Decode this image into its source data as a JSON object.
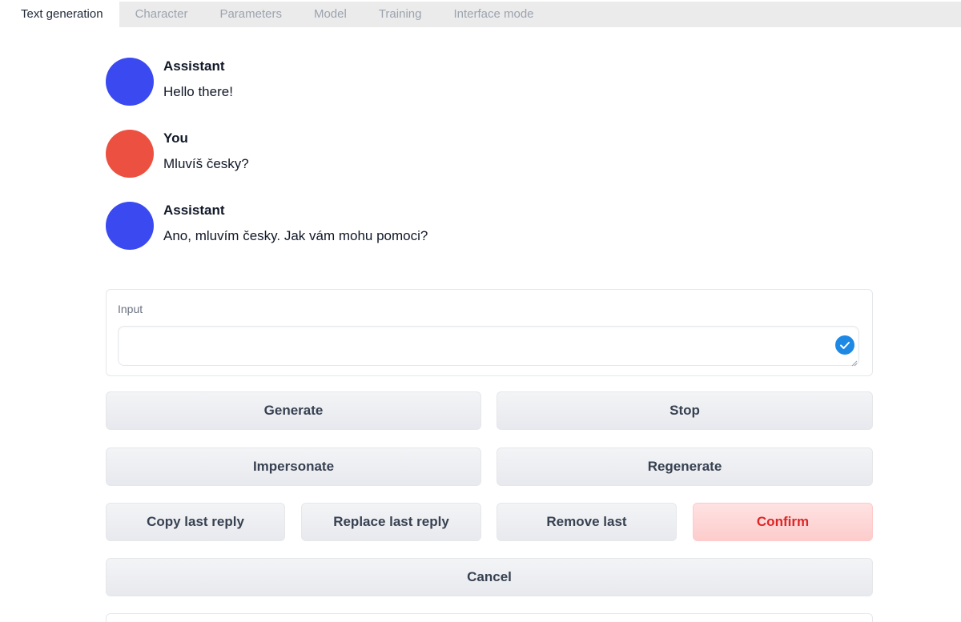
{
  "tabs": [
    {
      "label": "Text generation"
    },
    {
      "label": "Character"
    },
    {
      "label": "Parameters"
    },
    {
      "label": "Model"
    },
    {
      "label": "Training"
    },
    {
      "label": "Interface mode"
    }
  ],
  "chat": {
    "messages": [
      {
        "name": "Assistant",
        "text": "Hello there!",
        "avatar_color": "#3a49f0"
      },
      {
        "name": "You",
        "text": "Mluvíš česky?",
        "avatar_color": "#ec5040"
      },
      {
        "name": "Assistant",
        "text": "Ano, mluvím česky. Jak vám mohu pomoci?",
        "avatar_color": "#3a49f0"
      }
    ]
  },
  "input": {
    "label": "Input",
    "value": "",
    "status_icon": "checkmark-circle-icon"
  },
  "buttons": {
    "generate": "Generate",
    "stop": "Stop",
    "impersonate": "Impersonate",
    "regenerate": "Regenerate",
    "copy_last_reply": "Copy last reply",
    "replace_last_reply": "Replace last reply",
    "remove_last": "Remove last",
    "confirm": "Confirm",
    "cancel": "Cancel"
  },
  "colors": {
    "assistant_avatar": "#3a49f0",
    "user_avatar": "#ec5040",
    "confirm_text": "#dc2626",
    "confirm_bg": "#fee2e2",
    "check_icon": "#1e88e5"
  }
}
